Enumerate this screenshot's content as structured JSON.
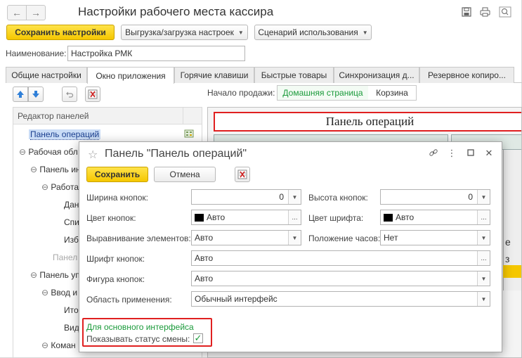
{
  "window": {
    "title": "Настройки рабочего места кассира"
  },
  "icons": {
    "back": "arrow-left-icon",
    "forward": "arrow-right-icon",
    "save": "floppy-icon",
    "print": "printer-icon",
    "preview": "zoom-icon",
    "star": "star-icon",
    "link": "link-icon",
    "more": "more-vert-icon",
    "maximize": "maximize-icon",
    "close": "close-icon",
    "clear": "clear-icon"
  },
  "colors": {
    "accent_yellow": "#f5c700",
    "link_green": "#1a9a3a",
    "highlight_red": "#e02020",
    "selection_blue": "#3c6fd6"
  },
  "toolbar": {
    "save_settings": "Сохранить настройки",
    "export_import": "Выгрузка/загрузка настроек",
    "usage_scenario": "Сценарий использования"
  },
  "name_field": {
    "label": "Наименование:",
    "value": "Настройка РМК"
  },
  "tabs": [
    {
      "label": "Общие настройки"
    },
    {
      "label": "Окно приложения"
    },
    {
      "label": "Горячие клавиши"
    },
    {
      "label": "Быстрые товары"
    },
    {
      "label": "Синхронизация д..."
    },
    {
      "label": "Резервное копиро..."
    }
  ],
  "sale_start": {
    "label": "Начало продажи:",
    "options": [
      "Домашняя страница",
      "Корзина"
    ]
  },
  "tree": {
    "header": "Редактор панелей",
    "items": [
      {
        "label": "Панель операций"
      },
      {
        "label": "Рабочая обл"
      },
      {
        "label": "Панель ин"
      },
      {
        "label": "Работа"
      },
      {
        "label": "Дан"
      },
      {
        "label": "Спи"
      },
      {
        "label": "Изб"
      },
      {
        "label": "Панел"
      },
      {
        "label": "Панель уп"
      },
      {
        "label": "Ввод и"
      },
      {
        "label": "Ито"
      },
      {
        "label": "Вид"
      },
      {
        "label": "Коман"
      }
    ]
  },
  "preview": {
    "panel_title": "Панель операций",
    "partial_chars": [
      "е",
      "з"
    ]
  },
  "dialog": {
    "title": "Панель \"Панель операций\"",
    "save": "Сохранить",
    "cancel": "Отмена",
    "fields": {
      "button_width": {
        "label": "Ширина кнопок:",
        "value": "0"
      },
      "button_height": {
        "label": "Высота кнопок:",
        "value": "0"
      },
      "button_color": {
        "label": "Цвет кнопок:",
        "value": "Авто"
      },
      "font_color": {
        "label": "Цвет шрифта:",
        "value": "Авто"
      },
      "align": {
        "label": "Выравнивание элементов:",
        "value": "Авто"
      },
      "clock_position": {
        "label": "Положение часов:",
        "value": "Нет"
      },
      "button_font": {
        "label": "Шрифт кнопок:",
        "value": "Авто"
      },
      "button_shape": {
        "label": "Фигура кнопок:",
        "value": "Авто"
      },
      "scope": {
        "label": "Область применения:",
        "value": "Обычный интерфейс"
      }
    },
    "section_title": "Для основного интерфейса",
    "show_shift_status": {
      "label": "Показывать статус смены:",
      "checked": true,
      "mark": "✓"
    }
  }
}
